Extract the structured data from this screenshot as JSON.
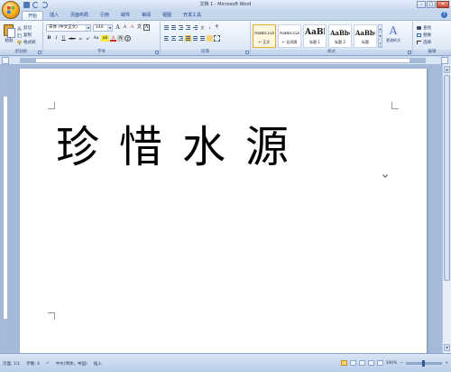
{
  "window": {
    "title": "文档 1 - Microsoft Word",
    "minimize": "–",
    "maximize": "□",
    "close": "✕"
  },
  "tabs": [
    {
      "label": "开始",
      "active": true
    },
    {
      "label": "插入"
    },
    {
      "label": "页面布局"
    },
    {
      "label": "引用"
    },
    {
      "label": "邮件"
    },
    {
      "label": "审阅"
    },
    {
      "label": "视图"
    },
    {
      "label": "开发工具"
    }
  ],
  "help_label": "?",
  "clipboard": {
    "paste": "粘贴",
    "cut": "剪切",
    "copy": "复制",
    "format_painter": "格式刷",
    "group": "剪贴板"
  },
  "font": {
    "name": "宋体 (中文正文)",
    "size": "140",
    "group": "字体",
    "grow": "A",
    "shrink": "A",
    "clear": "A",
    "phonetic": "文",
    "border": "A",
    "bold": "B",
    "italic": "I",
    "underline": "U",
    "strike": "abe",
    "subscript": "x₂",
    "superscript": "x²",
    "case": "Aa",
    "highlight": "ab",
    "color": "A",
    "shade": "A",
    "enclose": "字"
  },
  "paragraph": {
    "group": "段落"
  },
  "styles": {
    "group": "样式",
    "items": [
      {
        "sample": "AaBbCcDd",
        "name": "↵ 正文",
        "selected": true
      },
      {
        "sample": "AaBbCcDd",
        "name": "↵ 无间隔"
      },
      {
        "sample": "AaBl",
        "name": "标题 1"
      },
      {
        "sample": "AaBb(",
        "name": "标题 2"
      },
      {
        "sample": "AaBb(",
        "name": "标题"
      }
    ],
    "change": "更改样式"
  },
  "editing": {
    "group": "编辑",
    "find": "查找",
    "replace": "替换",
    "select": "选择"
  },
  "document": {
    "text": "珍惜水源"
  },
  "status": {
    "page": "页面: 1/1",
    "words": "字数: 4",
    "language": "中文(简体，中国)",
    "mode": "插入",
    "zoom": "100%"
  },
  "colors": {
    "ribbon_bg": "#e4edf8",
    "accent": "#15418f",
    "selected_style": "#e6a932",
    "highlight": "#f7c64c",
    "font_color": "#d4261c"
  }
}
